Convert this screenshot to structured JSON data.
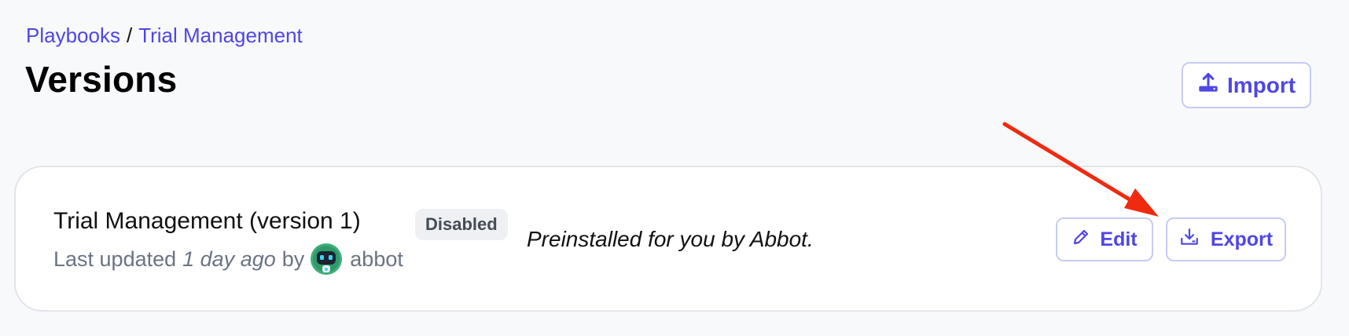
{
  "breadcrumb": {
    "parent": "Playbooks",
    "separator": "/",
    "current": "Trial Management"
  },
  "page_title": "Versions",
  "import_button": {
    "label": "Import",
    "icon": "upload-icon"
  },
  "version_card": {
    "title": "Trial Management (version 1)",
    "status_badge": "Disabled",
    "last_updated_prefix": "Last updated",
    "last_updated_ago": "1 day ago",
    "by": "by",
    "author": "abbot",
    "description": "Preinstalled for you by Abbot.",
    "edit_label": "Edit",
    "edit_icon": "pencil-icon",
    "export_label": "Export",
    "export_icon": "download-icon"
  },
  "annotation": {
    "color": "#f02a10",
    "points_to": "export-button"
  },
  "colors": {
    "accent": "#4f46e5",
    "button_border": "#c7cbf5",
    "background": "#f8f9fb"
  }
}
